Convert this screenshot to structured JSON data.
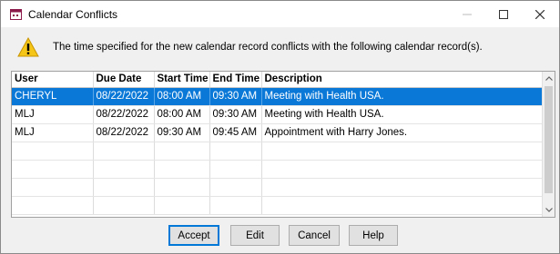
{
  "window": {
    "title": "Calendar Conflicts",
    "icon": "calendar-app-icon",
    "controls": [
      "minimize",
      "maximize",
      "close"
    ]
  },
  "message": {
    "icon": "warning-icon",
    "text": "The time specified for the new calendar record conflicts with the following calendar record(s)."
  },
  "grid": {
    "columns": [
      "User",
      "Due Date",
      "Start Time",
      "End Time",
      "Description"
    ],
    "rows": [
      {
        "user": "CHERYL",
        "due_date": "08/22/2022",
        "start_time": "08:00 AM",
        "end_time": "09:30 AM",
        "description": "Meeting with Health USA.",
        "selected": true
      },
      {
        "user": "MLJ",
        "due_date": "08/22/2022",
        "start_time": "08:00 AM",
        "end_time": "09:30 AM",
        "description": "Meeting with Health USA.",
        "selected": false
      },
      {
        "user": "MLJ",
        "due_date": "08/22/2022",
        "start_time": "09:30 AM",
        "end_time": "09:45 AM",
        "description": "Appointment with Harry Jones.",
        "selected": false
      }
    ],
    "selection_color": "#0a78d7"
  },
  "buttons": {
    "accept": "Accept",
    "edit": "Edit",
    "cancel": "Cancel",
    "help": "Help"
  }
}
